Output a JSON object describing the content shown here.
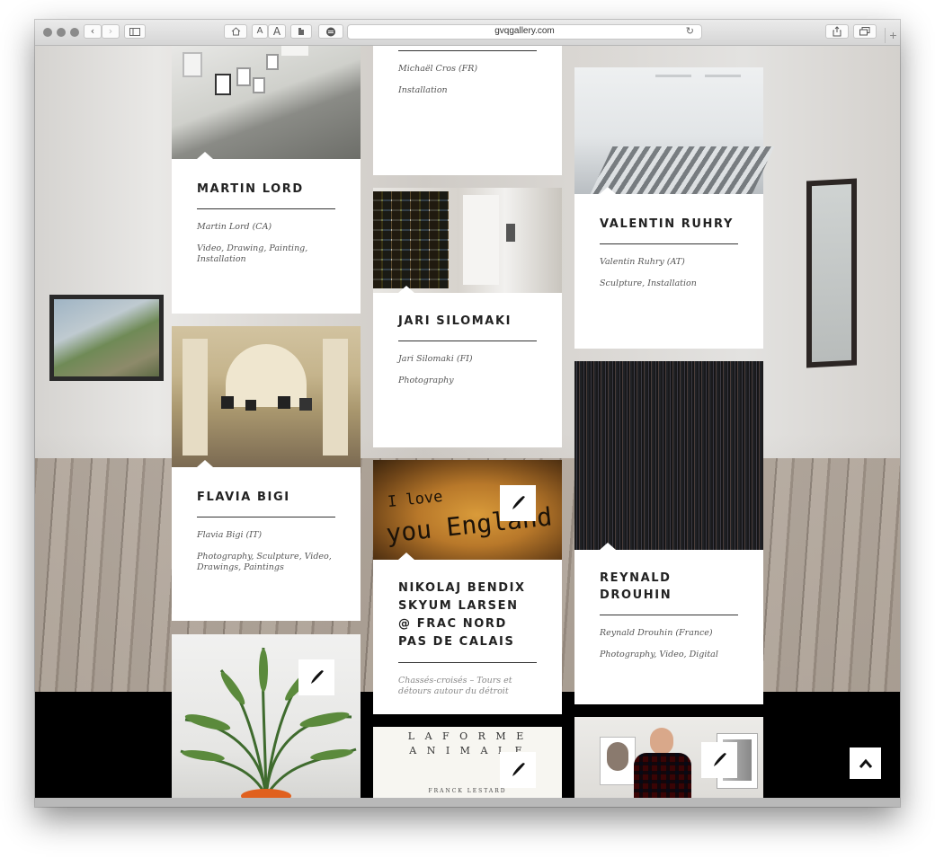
{
  "browser": {
    "url": "gvqgallery.com",
    "text_small_label": "A",
    "text_large_label": "A",
    "new_tab_label": "+"
  },
  "cards": {
    "michael": {
      "artist": "Michaël Cros (FR)",
      "disciplines": "Installation"
    },
    "martin": {
      "title": "MARTIN LORD",
      "artist": "Martin Lord (CA)",
      "disciplines": "Video, Drawing, Painting, Installation"
    },
    "valentin": {
      "title": "VALENTIN RUHRY",
      "artist": "Valentin Ruhry (AT)",
      "disciplines": "Sculpture, Installation"
    },
    "jari": {
      "title": "JARI SILOMAKI",
      "artist": "Jari Silomaki (FI)",
      "disciplines": "Photography"
    },
    "flavia": {
      "title": "FLAVIA BIGI",
      "artist": "Flavia Bigi (IT)",
      "disciplines": "Photography, Sculpture, Video, Drawings, Paintings"
    },
    "nikolaj": {
      "title": "NIKOLAJ BENDIX SKYUM LARSEN @ FRAC NORD PAS DE CALAIS",
      "subtitle": "Chassés-croisés – Tours et détours autour du détroit",
      "image_text_1": "I love",
      "image_text_2": "you England"
    },
    "reynald": {
      "title": "REYNALD DROUHIN",
      "artist": "Reynald Drouhin (France)",
      "disciplines": "Photography, Video, Digital"
    },
    "forme": {
      "line1": "L A   F O R M E",
      "line2": "A N I M A L E",
      "author": "FRANCK LESTARD"
    }
  },
  "icons": {
    "pen": "pen-icon",
    "scroll_top": "chevron-up-icon"
  },
  "colors": {
    "card_bg": "#ffffff",
    "heading": "#222222",
    "meta": "#555555",
    "strip": "#000000"
  }
}
